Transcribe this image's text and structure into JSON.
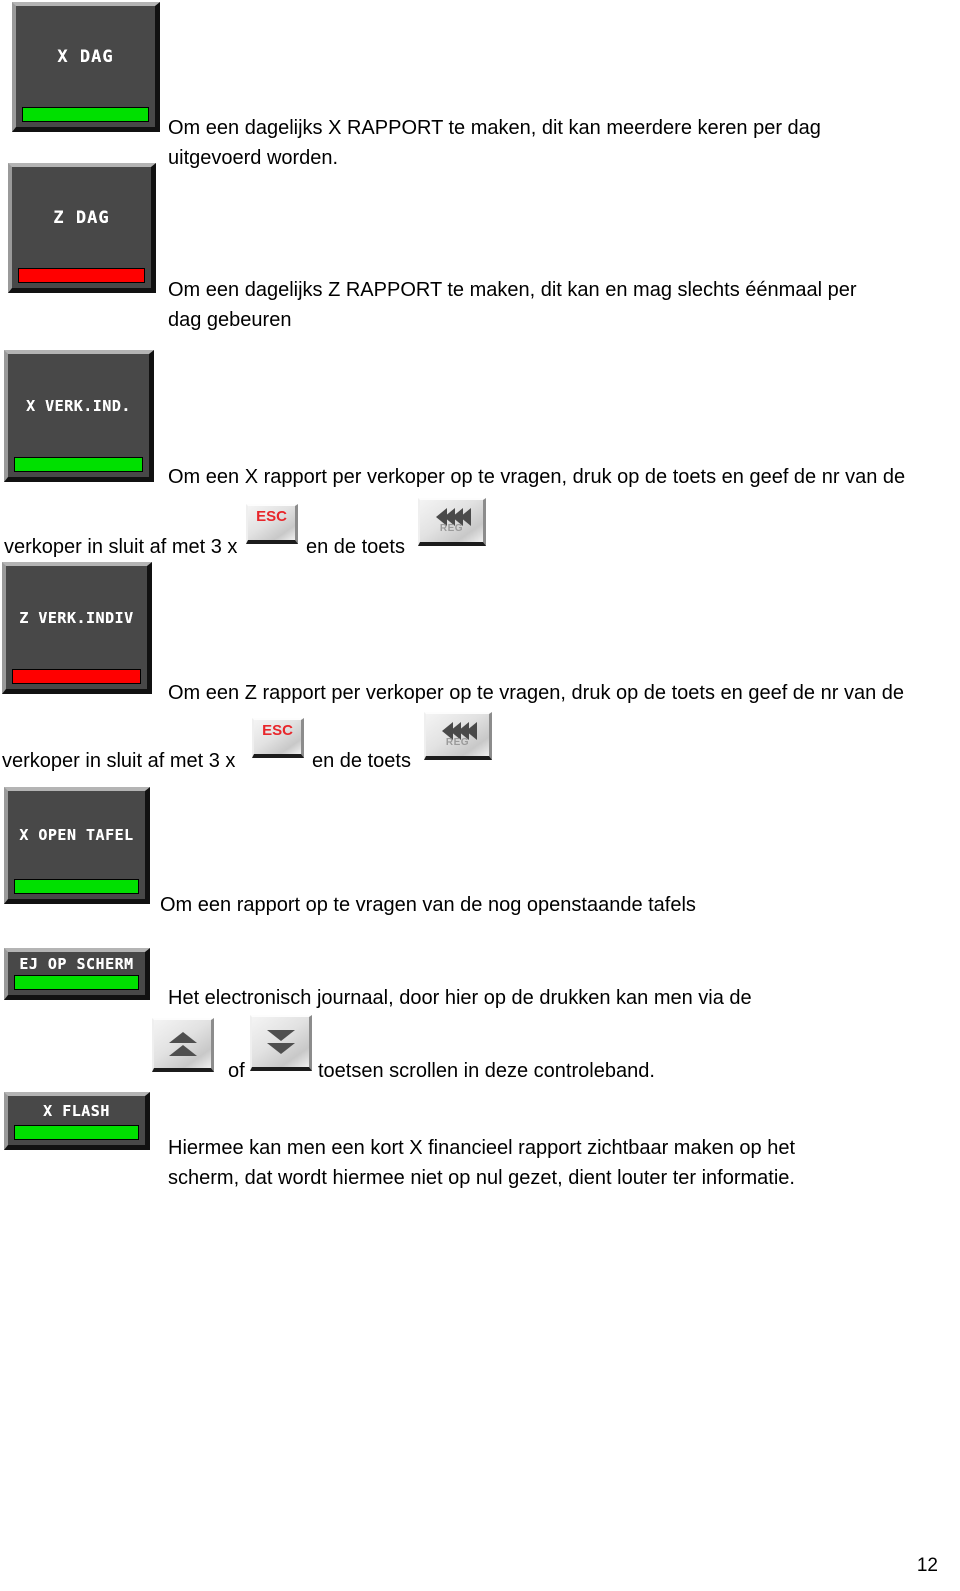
{
  "page": {
    "number": "12"
  },
  "keys": {
    "x_dag": {
      "legend": "X DAG",
      "lamp": "green"
    },
    "z_dag": {
      "legend": "Z DAG",
      "lamp": "red"
    },
    "x_verk_ind": {
      "legend": "X VERK.IND.",
      "lamp": "green"
    },
    "z_verk_indiv": {
      "legend": "Z VERK.INDIV",
      "lamp": "red"
    },
    "x_open_tafel": {
      "legend": "X OPEN TAFEL",
      "lamp": "green"
    },
    "ej_op_scherm": {
      "legend": "EJ OP SCHERM",
      "lamp": "green"
    },
    "x_flash": {
      "legend": "X FLASH",
      "lamp": "green"
    }
  },
  "kb_keys": {
    "esc": {
      "label": "ESC"
    },
    "reg": {
      "label": "REG"
    },
    "scroll_up": {
      "label": ""
    },
    "scroll_down": {
      "label": ""
    }
  },
  "descriptions": {
    "x_dag": "Om een dagelijks X RAPPORT te maken, dit kan meerdere keren per dag\nuitgevoerd worden.",
    "z_dag": "Om een dagelijks Z RAPPORT te maken, dit kan en mag slechts éénmaal per\ndag gebeuren",
    "x_verk_ind": "Om een X rapport per verkoper op te vragen, druk op de toets en geef de nr van de",
    "x_verk_ind_line2_a": "verkoper in sluit af met 3 x",
    "x_verk_ind_line2_b": "en de toets",
    "z_verk_indiv": "Om een Z rapport per verkoper op te vragen, druk op de toets en geef de nr van de",
    "z_verk_indiv_line2_a": "verkoper in sluit af met 3 x",
    "z_verk_indiv_line2_b": "en de toets",
    "x_open_tafel": "Om een rapport op te vragen van de nog openstaande tafels",
    "ej_op_scherm": "Het electronisch journaal, door hier op de drukken kan men via de",
    "ej_scroll_a": "of",
    "ej_scroll_b": "toetsen scrollen in deze controleband.",
    "x_flash": "Hiermee kan men een kort X financieel rapport zichtbaar maken op het\nscherm, dat wordt hiermee niet op nul gezet, dient louter ter informatie."
  },
  "colors": {
    "lamp_green": "#00e000",
    "lamp_red": "#ff0000",
    "key_body": "#484848",
    "esc_red": "#e8262b"
  }
}
